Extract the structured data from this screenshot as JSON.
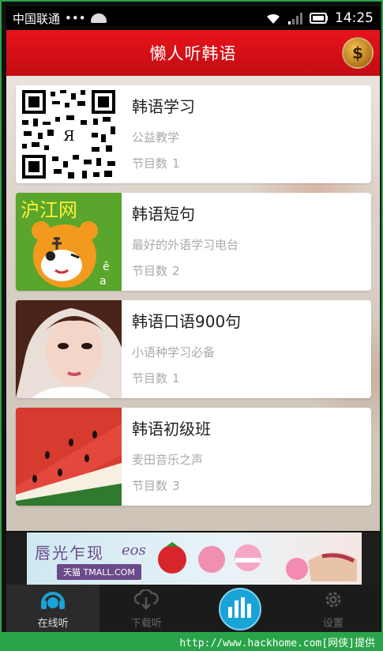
{
  "statusbar": {
    "carrier": "中国联通",
    "dots": "•••",
    "time": "14:25"
  },
  "header": {
    "title": "懒人听韩语",
    "money_symbol": "$"
  },
  "programs": [
    {
      "title": "韩语学习",
      "subtitle": "公益教学",
      "count_label": "节目数",
      "count": "1",
      "thumb": "qr-code"
    },
    {
      "title": "韩语短句",
      "subtitle": "最好的外语学习电台",
      "count_label": "节目数",
      "count": "2",
      "thumb": "hujiang-tiger"
    },
    {
      "title": "韩语口语900句",
      "subtitle": "小语种学习必备",
      "count_label": "节目数",
      "count": "1",
      "thumb": "portrait"
    },
    {
      "title": "韩语初级班",
      "subtitle": "麦田音乐之声",
      "count_label": "节目数",
      "count": "3",
      "thumb": "watermelon"
    }
  ],
  "thumbs": {
    "hujiang_text": "沪江网"
  },
  "ad": {
    "title": "唇光乍现",
    "brand": "eos",
    "tmall": "天猫 TMALL.COM"
  },
  "bottomnav": {
    "tabs": [
      {
        "label": "在线听",
        "icon": "headphones-icon",
        "active": true
      },
      {
        "label": "下载听",
        "icon": "cloud-download-icon",
        "active": false
      },
      {
        "label": "",
        "icon": "equalizer-icon",
        "active": false
      },
      {
        "label": "设置",
        "icon": "gear-icon",
        "active": false
      }
    ]
  },
  "footer": {
    "text": "http://www.hackhome.com[网侠]提供"
  },
  "colors": {
    "header_red": "#d8121a",
    "accent_blue": "#1aa3d6",
    "footer_green": "#2aa44a"
  }
}
